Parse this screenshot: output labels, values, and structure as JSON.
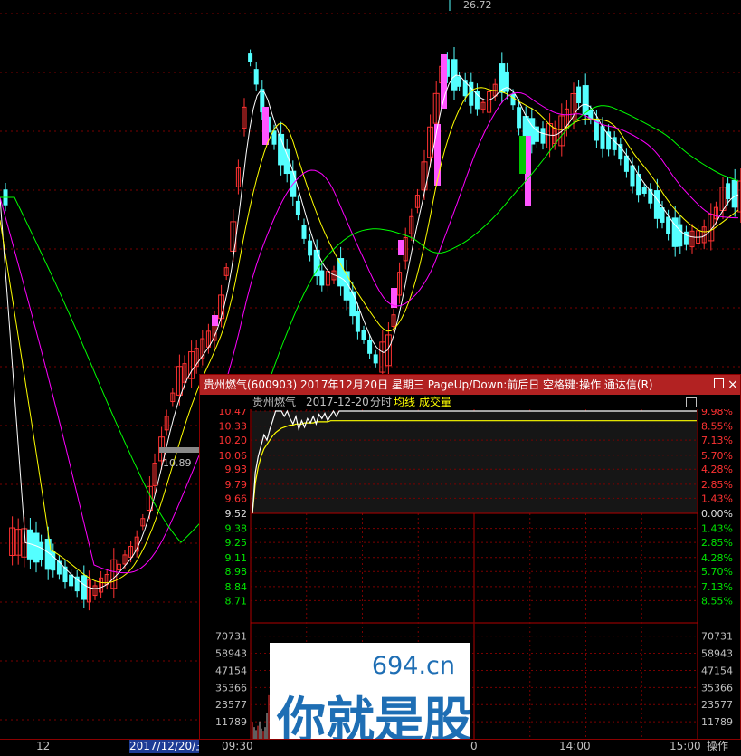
{
  "kline": {
    "peak_label": "26.72",
    "low_label": "10.89",
    "date_axis": [
      "12",
      "2017/12/20/三"
    ]
  },
  "popup": {
    "title": "贵州燃气(600903) 2017年12月20日 星期三 PageUp/Down:前后日 空格键:操作 通达信(R)",
    "stock_name": "贵州燃气",
    "date": "2017-12-20",
    "mode": "分时",
    "avg_label": "均线",
    "vol_label": "成交量",
    "close_glyph": "×"
  },
  "chart_data": {
    "type": "line",
    "title": "贵州燃气 2017-12-20 分时",
    "price_axis": [
      "10.47",
      "10.33",
      "10.20",
      "10.06",
      "9.93",
      "9.79",
      "9.66",
      "9.52",
      "9.38",
      "9.25",
      "9.11",
      "8.98",
      "8.84",
      "8.71"
    ],
    "pct_axis": [
      "9.98%",
      "8.55%",
      "7.13%",
      "5.70%",
      "4.28%",
      "2.85%",
      "1.43%",
      "0.00%",
      "1.43%",
      "2.85%",
      "4.28%",
      "5.70%",
      "7.13%",
      "8.55%"
    ],
    "volume_axis": [
      "70731",
      "58943",
      "47154",
      "35366",
      "23577",
      "11789"
    ],
    "time_axis": [
      "09:30",
      "14:00",
      "15:00"
    ],
    "prev_close": 9.52,
    "limit_up": 10.47,
    "ylim": [
      8.57,
      10.47
    ],
    "price_series": [
      9.52,
      9.9,
      10.05,
      10.15,
      10.25,
      10.2,
      10.3,
      10.38,
      10.47,
      10.47,
      10.47,
      10.42,
      10.47,
      10.4,
      10.35,
      10.42,
      10.3,
      10.38,
      10.32,
      10.4,
      10.36,
      10.42,
      10.35,
      10.44,
      10.4,
      10.45,
      10.38,
      10.43,
      10.47,
      10.42,
      10.47,
      10.47,
      10.47
    ],
    "avg_series": [
      9.52,
      9.8,
      9.95,
      10.05,
      10.12,
      10.16,
      10.2,
      10.24,
      10.27,
      10.29,
      10.31,
      10.32,
      10.33,
      10.34,
      10.34,
      10.35,
      10.35,
      10.35,
      10.36,
      10.36,
      10.36,
      10.36,
      10.37,
      10.37,
      10.37,
      10.37,
      10.37,
      10.38,
      10.38,
      10.38,
      10.38,
      10.38,
      10.38
    ],
    "volume_series": [
      11789,
      8000,
      6000,
      9000,
      12000,
      7000,
      5500,
      8000,
      18000,
      30000,
      25000,
      14000,
      9000,
      7000,
      6000,
      8500,
      5000,
      6500,
      4500,
      7000,
      4000,
      5500,
      3800,
      5000,
      4200,
      6000,
      3500,
      4000,
      5200,
      3000,
      2500,
      2200,
      2000
    ]
  },
  "watermark": {
    "site": "694.cn",
    "slogan": "你就是股神"
  },
  "bottom_bar": {
    "time_center": "0",
    "time_1400": "14:00",
    "time_1500": "15:00",
    "action": "操作"
  },
  "colors": {
    "up": "#ff3232",
    "down": "#54ffff",
    "ma": "#ffffff",
    "title_bg": "#b22222"
  }
}
